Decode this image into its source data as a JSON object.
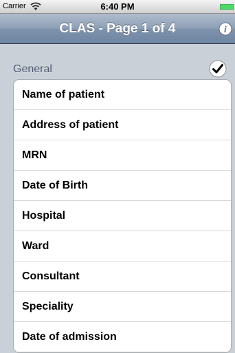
{
  "status_bar": {
    "carrier": "Carrier",
    "time": "6:40 PM",
    "battery_color": "#4cd964"
  },
  "nav": {
    "title": "CLAS - Page 1 of 4",
    "info_icon": "info-icon"
  },
  "section": {
    "label": "General",
    "checked": true
  },
  "rows": [
    {
      "label": "Name of patient"
    },
    {
      "label": "Address of patient"
    },
    {
      "label": "MRN"
    },
    {
      "label": "Date of Birth"
    },
    {
      "label": "Hospital"
    },
    {
      "label": "Ward"
    },
    {
      "label": "Consultant"
    },
    {
      "label": "Speciality"
    },
    {
      "label": "Date of admission"
    }
  ]
}
